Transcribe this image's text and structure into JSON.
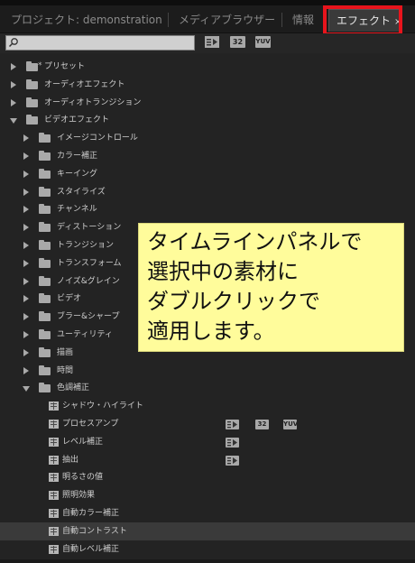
{
  "tabs": [
    {
      "label": "プロジェクト: demonstration",
      "active": false
    },
    {
      "label": "メディアブラウザー",
      "active": false
    },
    {
      "label": "情報",
      "active": false
    },
    {
      "label": "エフェクト",
      "active": true,
      "close": "×"
    }
  ],
  "toolbar": {
    "search_value": "",
    "badges": [
      "32",
      "YUV"
    ]
  },
  "tree": [
    {
      "label": "プリセット",
      "kind": "folder",
      "level": 0,
      "expanded": false,
      "star": true
    },
    {
      "label": "オーディオエフェクト",
      "kind": "folder",
      "level": 0,
      "expanded": false
    },
    {
      "label": "オーディオトランジション",
      "kind": "folder",
      "level": 0,
      "expanded": false
    },
    {
      "label": "ビデオエフェクト",
      "kind": "folder",
      "level": 0,
      "expanded": true
    },
    {
      "label": "イメージコントロール",
      "kind": "folder",
      "level": 1,
      "expanded": false
    },
    {
      "label": "カラー補正",
      "kind": "folder",
      "level": 1,
      "expanded": false
    },
    {
      "label": "キーイング",
      "kind": "folder",
      "level": 1,
      "expanded": false
    },
    {
      "label": "スタイライズ",
      "kind": "folder",
      "level": 1,
      "expanded": false
    },
    {
      "label": "チャンネル",
      "kind": "folder",
      "level": 1,
      "expanded": false
    },
    {
      "label": "ディストーション",
      "kind": "folder",
      "level": 1,
      "expanded": false
    },
    {
      "label": "トランジション",
      "kind": "folder",
      "level": 1,
      "expanded": false
    },
    {
      "label": "トランスフォーム",
      "kind": "folder",
      "level": 1,
      "expanded": false
    },
    {
      "label": "ノイズ&グレイン",
      "kind": "folder",
      "level": 1,
      "expanded": false
    },
    {
      "label": "ビデオ",
      "kind": "folder",
      "level": 1,
      "expanded": false
    },
    {
      "label": "ブラー&シャープ",
      "kind": "folder",
      "level": 1,
      "expanded": false
    },
    {
      "label": "ユーティリティ",
      "kind": "folder",
      "level": 1,
      "expanded": false
    },
    {
      "label": "描画",
      "kind": "folder",
      "level": 1,
      "expanded": false
    },
    {
      "label": "時間",
      "kind": "folder",
      "level": 1,
      "expanded": false
    },
    {
      "label": "色調補正",
      "kind": "folder",
      "level": 1,
      "expanded": true
    },
    {
      "label": "シャドウ・ハイライト",
      "kind": "effect",
      "level": 2
    },
    {
      "label": "プロセスアンプ",
      "kind": "effect",
      "level": 2,
      "badges": [
        "accel",
        "32",
        "YUV"
      ]
    },
    {
      "label": "レベル補正",
      "kind": "effect",
      "level": 2,
      "badges": [
        "accel"
      ]
    },
    {
      "label": "抽出",
      "kind": "effect",
      "level": 2,
      "badges": [
        "accel"
      ]
    },
    {
      "label": "明るさの値",
      "kind": "effect",
      "level": 2
    },
    {
      "label": "照明効果",
      "kind": "effect",
      "level": 2
    },
    {
      "label": "自動カラー補正",
      "kind": "effect",
      "level": 2
    },
    {
      "label": "自動コントラスト",
      "kind": "effect",
      "level": 2,
      "selected": true
    },
    {
      "label": "自動レベル補正",
      "kind": "effect",
      "level": 2
    }
  ],
  "callout": {
    "lines": [
      "タイムラインパネルで",
      "選択中の素材に",
      "ダブルクリックで",
      "適用します。"
    ]
  },
  "colors": {
    "highlight_border": "#e8141c",
    "callout_bg": "#fffc9b",
    "panel_bg": "#232323"
  }
}
